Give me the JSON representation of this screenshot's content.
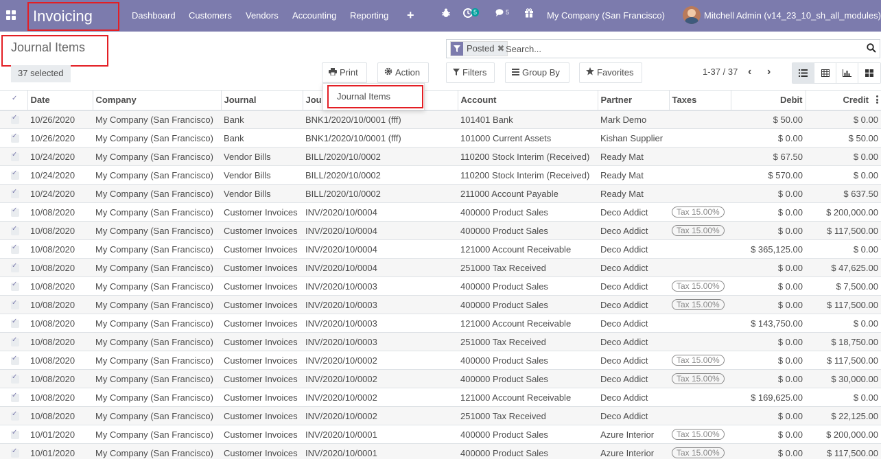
{
  "navbar": {
    "app_title": "Invoicing",
    "menus": [
      "Dashboard",
      "Customers",
      "Vendors",
      "Accounting",
      "Reporting"
    ],
    "plus": "+",
    "activity_count": "5",
    "messages_count": "5",
    "company": "My Company (San Francisco)",
    "user": "Mitchell Admin (v14_23_10_sh_all_modules)"
  },
  "control": {
    "breadcrumb": "Journal Items",
    "selected": "37 selected",
    "print_label": "Print",
    "action_label": "Action",
    "filters_label": "Filters",
    "groupby_label": "Group By",
    "favorites_label": "Favorites",
    "pager": "1-37 / 37",
    "prev": "‹",
    "next": "›"
  },
  "search": {
    "facet_value": "Posted",
    "facet_remove": "✖",
    "placeholder": "Search..."
  },
  "dropdown": {
    "item": "Journal Items"
  },
  "table": {
    "headers": [
      "",
      "Date",
      "Company",
      "Journal",
      "Jou",
      "Account",
      "Partner",
      "Taxes",
      "Debit",
      "Credit"
    ],
    "rows": [
      [
        "10/26/2020",
        "My Company (San Francisco)",
        "Bank",
        "BNK1/2020/10/0001 (fff)",
        "101401 Bank",
        "Mark Demo",
        "",
        "$ 50.00",
        "$ 0.00"
      ],
      [
        "10/26/2020",
        "My Company (San Francisco)",
        "Bank",
        "BNK1/2020/10/0001 (fff)",
        "101000 Current Assets",
        "Kishan Supplier",
        "",
        "$ 0.00",
        "$ 50.00"
      ],
      [
        "10/24/2020",
        "My Company (San Francisco)",
        "Vendor Bills",
        "BILL/2020/10/0002",
        "110200 Stock Interim (Received)",
        "Ready Mat",
        "",
        "$ 67.50",
        "$ 0.00"
      ],
      [
        "10/24/2020",
        "My Company (San Francisco)",
        "Vendor Bills",
        "BILL/2020/10/0002",
        "110200 Stock Interim (Received)",
        "Ready Mat",
        "",
        "$ 570.00",
        "$ 0.00"
      ],
      [
        "10/24/2020",
        "My Company (San Francisco)",
        "Vendor Bills",
        "BILL/2020/10/0002",
        "211000 Account Payable",
        "Ready Mat",
        "",
        "$ 0.00",
        "$ 637.50"
      ],
      [
        "10/08/2020",
        "My Company (San Francisco)",
        "Customer Invoices",
        "INV/2020/10/0004",
        "400000 Product Sales",
        "Deco Addict",
        "Tax 15.00%",
        "$ 0.00",
        "$ 200,000.00"
      ],
      [
        "10/08/2020",
        "My Company (San Francisco)",
        "Customer Invoices",
        "INV/2020/10/0004",
        "400000 Product Sales",
        "Deco Addict",
        "Tax 15.00%",
        "$ 0.00",
        "$ 117,500.00"
      ],
      [
        "10/08/2020",
        "My Company (San Francisco)",
        "Customer Invoices",
        "INV/2020/10/0004",
        "121000 Account Receivable",
        "Deco Addict",
        "",
        "$ 365,125.00",
        "$ 0.00"
      ],
      [
        "10/08/2020",
        "My Company (San Francisco)",
        "Customer Invoices",
        "INV/2020/10/0004",
        "251000 Tax Received",
        "Deco Addict",
        "",
        "$ 0.00",
        "$ 47,625.00"
      ],
      [
        "10/08/2020",
        "My Company (San Francisco)",
        "Customer Invoices",
        "INV/2020/10/0003",
        "400000 Product Sales",
        "Deco Addict",
        "Tax 15.00%",
        "$ 0.00",
        "$ 7,500.00"
      ],
      [
        "10/08/2020",
        "My Company (San Francisco)",
        "Customer Invoices",
        "INV/2020/10/0003",
        "400000 Product Sales",
        "Deco Addict",
        "Tax 15.00%",
        "$ 0.00",
        "$ 117,500.00"
      ],
      [
        "10/08/2020",
        "My Company (San Francisco)",
        "Customer Invoices",
        "INV/2020/10/0003",
        "121000 Account Receivable",
        "Deco Addict",
        "",
        "$ 143,750.00",
        "$ 0.00"
      ],
      [
        "10/08/2020",
        "My Company (San Francisco)",
        "Customer Invoices",
        "INV/2020/10/0003",
        "251000 Tax Received",
        "Deco Addict",
        "",
        "$ 0.00",
        "$ 18,750.00"
      ],
      [
        "10/08/2020",
        "My Company (San Francisco)",
        "Customer Invoices",
        "INV/2020/10/0002",
        "400000 Product Sales",
        "Deco Addict",
        "Tax 15.00%",
        "$ 0.00",
        "$ 117,500.00"
      ],
      [
        "10/08/2020",
        "My Company (San Francisco)",
        "Customer Invoices",
        "INV/2020/10/0002",
        "400000 Product Sales",
        "Deco Addict",
        "Tax 15.00%",
        "$ 0.00",
        "$ 30,000.00"
      ],
      [
        "10/08/2020",
        "My Company (San Francisco)",
        "Customer Invoices",
        "INV/2020/10/0002",
        "121000 Account Receivable",
        "Deco Addict",
        "",
        "$ 169,625.00",
        "$ 0.00"
      ],
      [
        "10/08/2020",
        "My Company (San Francisco)",
        "Customer Invoices",
        "INV/2020/10/0002",
        "251000 Tax Received",
        "Deco Addict",
        "",
        "$ 0.00",
        "$ 22,125.00"
      ],
      [
        "10/01/2020",
        "My Company (San Francisco)",
        "Customer Invoices",
        "INV/2020/10/0001",
        "400000 Product Sales",
        "Azure Interior",
        "Tax 15.00%",
        "$ 0.00",
        "$ 200,000.00"
      ],
      [
        "10/01/2020",
        "My Company (San Francisco)",
        "Customer Invoices",
        "INV/2020/10/0001",
        "400000 Product Sales",
        "Azure Interior",
        "Tax 15.00%",
        "$ 0.00",
        "$ 117,500.00"
      ]
    ]
  },
  "colors": {
    "navbar": "#7c7bad",
    "highlight_border": "#e31e24",
    "badge": "#00a09d"
  },
  "icons": [
    "apps-grid-icon",
    "bug-icon",
    "activity-clock-icon",
    "chat-icon",
    "gift-icon",
    "print-icon",
    "gear-icon",
    "filter-icon",
    "list-icon",
    "star-icon",
    "search-icon",
    "list-view-icon",
    "pivot-view-icon",
    "graph-view-icon",
    "kanban-view-icon",
    "column-options-icon"
  ]
}
